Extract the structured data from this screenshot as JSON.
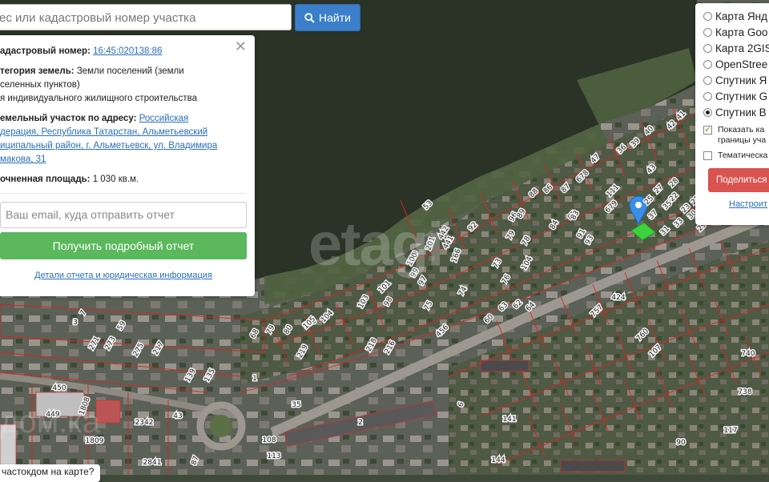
{
  "search": {
    "value": "ес или кадастровый номер участка",
    "button_label": "Найти"
  },
  "info": {
    "cadastral_label": "адастровый номер:",
    "cadastral_number": "16:45:020138:86",
    "category_label": "тегория земель:",
    "category_value": "Земли поселений (земли",
    "category_line2": "селенных пунктов)",
    "category_line3": "я индивидуального жилищного строительства",
    "address_label": "емельный участок по адресу:",
    "address_l1": "Российская",
    "address_l2": "дерация, Республика Татарстан, Альметьевский",
    "address_l3": "иципальный район, г. Альметьевск, ул. Владимира",
    "address_l4": "макова, 31",
    "area_label": "очненная площадь:",
    "area_value": "1 030 кв.м.",
    "email_placeholder": "Ваш email, куда отправить отчет",
    "report_button": "Получить подробный отчет",
    "details_link": "Детали отчета и юридическая информация"
  },
  "layers": {
    "options": [
      {
        "label": "Карта Янд",
        "selected": false
      },
      {
        "label": "Карта Goo",
        "selected": false
      },
      {
        "label": "Карта 2GIS",
        "selected": false
      },
      {
        "label": "OpenStree",
        "selected": false
      },
      {
        "label": "Спутник Я",
        "selected": false
      },
      {
        "label": "Спутник G",
        "selected": false
      },
      {
        "label": "Спутник B",
        "selected": true
      }
    ],
    "show_boundaries_l1": "Показать ка",
    "show_boundaries_l2": "границы уча",
    "show_boundaries_checked": true,
    "thematic_label": "Тематическа",
    "thematic_checked": false,
    "share_button": "Поделиться",
    "settings_link": "Настроит"
  },
  "bottom_chip": "частокдом на карте?",
  "watermark": "etagi",
  "watermark2": "дом.ка",
  "plots": [
    {
      "n": "53"
    },
    {
      "n": "92"
    },
    {
      "n": "88"
    },
    {
      "n": "86"
    },
    {
      "n": "87"
    },
    {
      "n": "85"
    },
    {
      "n": "111"
    },
    {
      "n": "679"
    },
    {
      "n": "678"
    },
    {
      "n": "47"
    },
    {
      "n": "43"
    },
    {
      "n": "42"
    },
    {
      "n": "41"
    },
    {
      "n": "40"
    },
    {
      "n": "36"
    },
    {
      "n": "39"
    },
    {
      "n": "37"
    },
    {
      "n": "35"
    },
    {
      "n": "33"
    },
    {
      "n": "31"
    },
    {
      "n": "30"
    },
    {
      "n": "29"
    },
    {
      "n": "28"
    },
    {
      "n": "22"
    },
    {
      "n": "27"
    },
    {
      "n": "25"
    },
    {
      "n": "23"
    },
    {
      "n": "21"
    },
    {
      "n": "442"
    },
    {
      "n": "441"
    },
    {
      "n": "201"
    },
    {
      "n": "180"
    },
    {
      "n": "166"
    },
    {
      "n": "96"
    },
    {
      "n": "89"
    },
    {
      "n": "83"
    },
    {
      "n": "84"
    },
    {
      "n": "91"
    },
    {
      "n": "93"
    },
    {
      "n": "79"
    },
    {
      "n": "78"
    },
    {
      "n": "73"
    },
    {
      "n": "76"
    },
    {
      "n": "104"
    },
    {
      "n": "105"
    },
    {
      "n": "101"
    },
    {
      "n": "97"
    },
    {
      "n": "99"
    },
    {
      "n": "100"
    },
    {
      "n": "75"
    },
    {
      "n": "74"
    },
    {
      "n": "98"
    },
    {
      "n": "103"
    },
    {
      "n": "104"
    },
    {
      "n": "105"
    },
    {
      "n": "79"
    },
    {
      "n": "80"
    },
    {
      "n": "68"
    },
    {
      "n": "63"
    },
    {
      "n": "62"
    },
    {
      "n": "64"
    },
    {
      "n": "60"
    },
    {
      "n": "456"
    },
    {
      "n": "219"
    },
    {
      "n": "218"
    },
    {
      "n": "216"
    },
    {
      "n": "450"
    },
    {
      "n": "449"
    },
    {
      "n": "1808"
    },
    {
      "n": "2342"
    },
    {
      "n": "1809"
    },
    {
      "n": "2841"
    },
    {
      "n": "1"
    },
    {
      "n": "2"
    },
    {
      "n": "6"
    },
    {
      "n": "141"
    },
    {
      "n": "144"
    },
    {
      "n": "740"
    },
    {
      "n": "738"
    },
    {
      "n": "117"
    },
    {
      "n": "90"
    },
    {
      "n": "424"
    },
    {
      "n": "760"
    },
    {
      "n": "757"
    },
    {
      "n": "107"
    },
    {
      "n": "108"
    },
    {
      "n": "113"
    },
    {
      "n": "139"
    },
    {
      "n": "135"
    },
    {
      "n": "271"
    },
    {
      "n": "273"
    },
    {
      "n": "275"
    },
    {
      "n": "217"
    },
    {
      "n": "59"
    },
    {
      "n": "3"
    },
    {
      "n": "7"
    },
    {
      "n": "35"
    },
    {
      "n": "87"
    },
    {
      "n": "43"
    }
  ]
}
